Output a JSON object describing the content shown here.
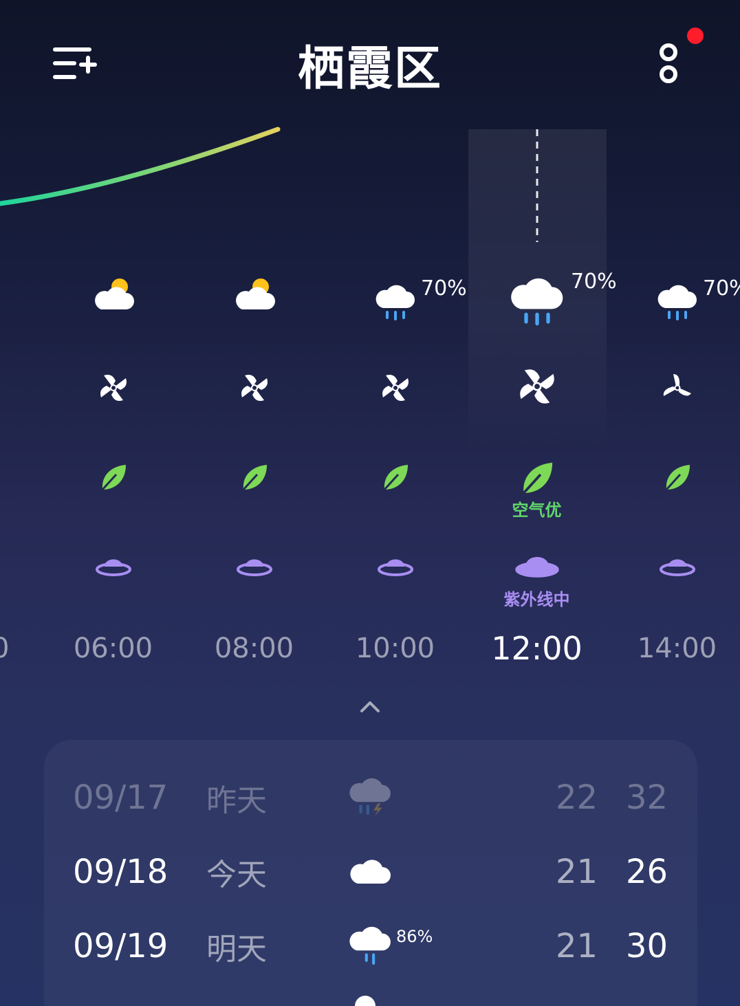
{
  "header": {
    "title": "栖霞区",
    "menu_icon": "add-city-menu-icon",
    "more_icon": "more-options-icon"
  },
  "colors": {
    "leaf_green": "#7ed957",
    "air_text": "#62d66b",
    "uv_purple": "#a98ef2",
    "uv_text": "#a98ef2",
    "notif": "#ff1d2b"
  },
  "hourly": [
    {
      "time": "06:00",
      "weather_icon": "partly-cloudy-icon",
      "precip": "",
      "wind_icon": "wind-icon",
      "air_icon": "leaf-icon",
      "uv_icon": "sun-hat-icon",
      "selected": false
    },
    {
      "time": "08:00",
      "weather_icon": "partly-cloudy-icon",
      "precip": "",
      "wind_icon": "wind-icon",
      "air_icon": "leaf-icon",
      "uv_icon": "sun-hat-icon",
      "selected": false
    },
    {
      "time": "10:00",
      "weather_icon": "rain-icon",
      "precip": "70%",
      "wind_icon": "wind-icon",
      "air_icon": "leaf-icon",
      "uv_icon": "sun-hat-icon",
      "selected": false
    },
    {
      "time": "12:00",
      "weather_icon": "rain-icon",
      "precip": "70%",
      "wind_icon": "wind-icon",
      "air_icon": "leaf-icon",
      "uv_icon": "sun-hat-icon",
      "selected": true,
      "air_label": "空气优",
      "uv_label": "紫外线中"
    },
    {
      "time": "14:00",
      "weather_icon": "rain-icon",
      "precip": "70%",
      "wind_icon": "wind-icon",
      "air_icon": "leaf-icon",
      "uv_icon": "sun-hat-icon",
      "selected": false
    }
  ],
  "daily": [
    {
      "date": "09/17",
      "day": "昨天",
      "icon": "thunderstorm-icon",
      "precip": "",
      "low": "22",
      "high": "32",
      "past": true
    },
    {
      "date": "09/18",
      "day": "今天",
      "icon": "cloudy-icon",
      "precip": "",
      "low": "21",
      "high": "26",
      "past": false
    },
    {
      "date": "09/19",
      "day": "明天",
      "icon": "rain-icon",
      "precip": "86%",
      "low": "21",
      "high": "30",
      "past": false
    }
  ]
}
